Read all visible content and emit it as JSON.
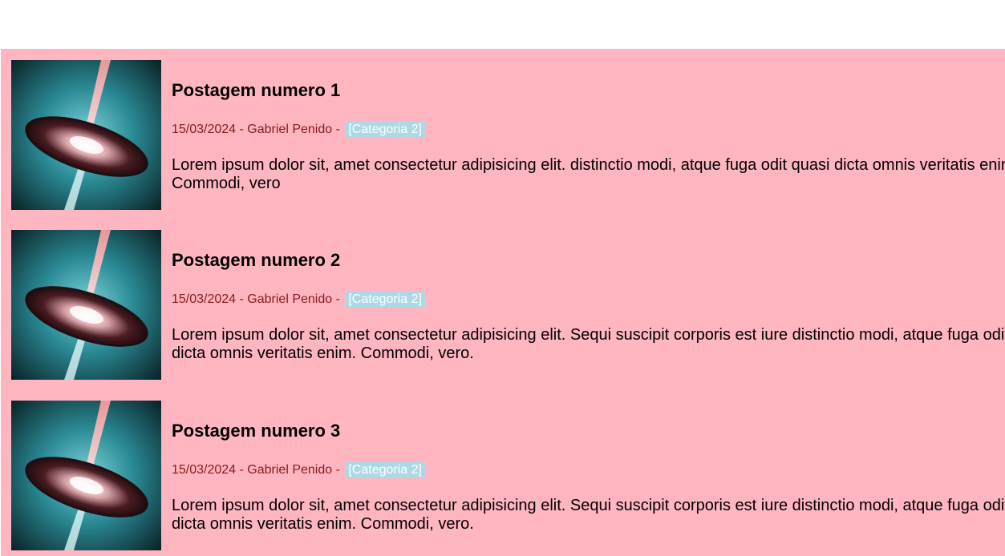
{
  "posts": [
    {
      "title": "Postagem numero 1",
      "date": "15/03/2024",
      "author": "Gabriel Penido",
      "category": "[Categoria 2]",
      "excerpt": "Lorem ipsum dolor sit, amet consectetur adipisicing elit. distinctio modi, atque fuga odit quasi dicta omnis veritatis enim. Commodi, vero"
    },
    {
      "title": "Postagem numero 2",
      "date": "15/03/2024",
      "author": "Gabriel Penido",
      "category": "[Categoria 2]",
      "excerpt": "Lorem ipsum dolor sit, amet consectetur adipisicing elit. Sequi suscipit corporis est iure distinctio modi, atque fuga odit quasi dicta omnis veritatis enim. Commodi, vero."
    },
    {
      "title": "Postagem numero 3",
      "date": "15/03/2024",
      "author": "Gabriel Penido",
      "category": "[Categoria 2]",
      "excerpt": "Lorem ipsum dolor sit, amet consectetur adipisicing elit. Sequi suscipit corporis est iure distinctio modi, atque fuga odit quasi dicta omnis veritatis enim. Commodi, vero."
    }
  ],
  "meta_separator": " - ",
  "colors": {
    "list_background": "#ffb6c1",
    "meta_text": "#8b1a1a",
    "badge_background": "#add8e6",
    "badge_text": "#ffffff"
  }
}
